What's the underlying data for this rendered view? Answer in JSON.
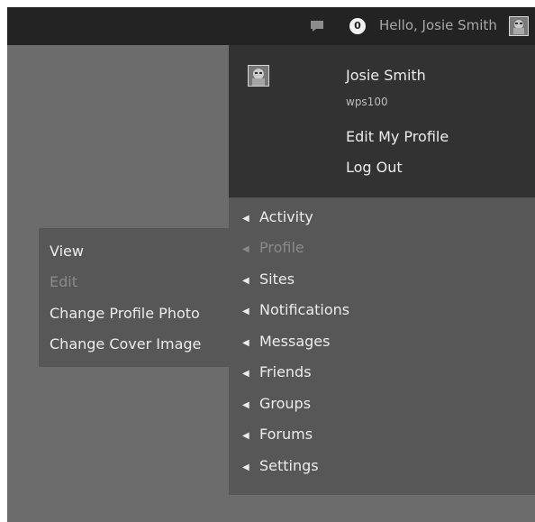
{
  "admin_bar": {
    "comment_icon": "comment-bubble-icon",
    "notification_count": "0",
    "greeting": "Hello, Josie Smith",
    "avatar_icon": "user-avatar-icon"
  },
  "account": {
    "display_name": "Josie Smith",
    "username": "wps100",
    "edit_profile": "Edit My Profile",
    "log_out": "Log Out"
  },
  "menu": {
    "arrow": "◀",
    "items": [
      {
        "label": "Activity"
      },
      {
        "label": "Profile"
      },
      {
        "label": "Sites"
      },
      {
        "label": "Notifications"
      },
      {
        "label": "Messages"
      },
      {
        "label": "Friends"
      },
      {
        "label": "Groups"
      },
      {
        "label": "Forums"
      },
      {
        "label": "Settings"
      }
    ]
  },
  "profile_submenu": {
    "items": [
      {
        "label": "View"
      },
      {
        "label": "Edit"
      },
      {
        "label": "Change Profile Photo"
      },
      {
        "label": "Change Cover Image"
      }
    ]
  },
  "colors": {
    "admin_bar": "#232323",
    "account_panel": "#323232",
    "menu_panel": "#575757",
    "page_background": "#6c6c6c",
    "text_light": "#ececec",
    "text_dim": "#8a8a8a"
  }
}
